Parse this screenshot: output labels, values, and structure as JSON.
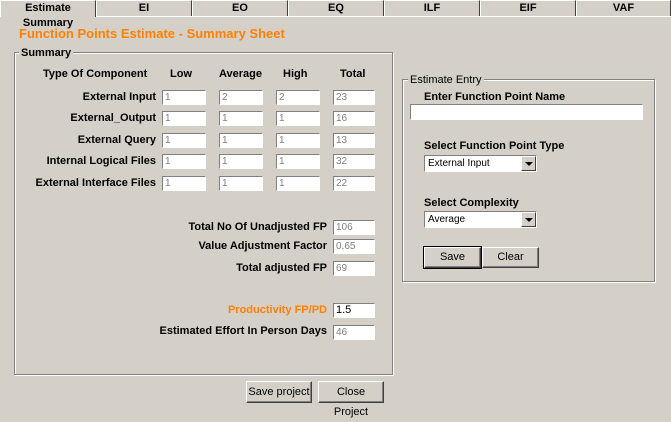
{
  "tabs": [
    "Estimate Summary",
    "EI",
    "EO",
    "EQ",
    "ILF",
    "EIF",
    "VAF"
  ],
  "page_title": "Function Points Estimate - Summary Sheet",
  "summary": {
    "legend": "Summary",
    "headers": {
      "type": "Type Of Component",
      "low": "Low",
      "average": "Average",
      "high": "High",
      "total": "Total"
    },
    "rows": [
      {
        "label": "External Input",
        "low": "1",
        "average": "2",
        "high": "2",
        "total": "23"
      },
      {
        "label": "External_Output",
        "low": "1",
        "average": "1",
        "high": "1",
        "total": "16"
      },
      {
        "label": "External Query",
        "low": "1",
        "average": "1",
        "high": "1",
        "total": "13"
      },
      {
        "label": "Internal Logical Files",
        "low": "1",
        "average": "1",
        "high": "1",
        "total": "32"
      },
      {
        "label": "External Interface Files",
        "low": "1",
        "average": "1",
        "high": "1",
        "total": "22"
      }
    ],
    "unadjusted_label": "Total No Of Unadjusted FP",
    "unadjusted_value": "106",
    "vaf_label": "Value Adjustment Factor",
    "vaf_value": "0.65",
    "adjusted_label": "Total adjusted FP",
    "adjusted_value": "69",
    "productivity_label": "Productivity FP/PD",
    "productivity_value": "1.5",
    "effort_label": "Estimated  Effort In Person Days",
    "effort_value": "46"
  },
  "entry": {
    "legend": "Estimate Entry",
    "name_label": "Enter Function Point Name",
    "name_value": "",
    "type_label": "Select Function Point Type",
    "type_value": "External Input",
    "complexity_label": "Select Complexity",
    "complexity_value": "Average",
    "save_label": "Save",
    "clear_label": "Clear"
  },
  "footer": {
    "save_project_label": "Save project",
    "close_project_label": "Close Project"
  },
  "colors": {
    "accent": "#ff8000",
    "background": "#d4d0c8"
  }
}
